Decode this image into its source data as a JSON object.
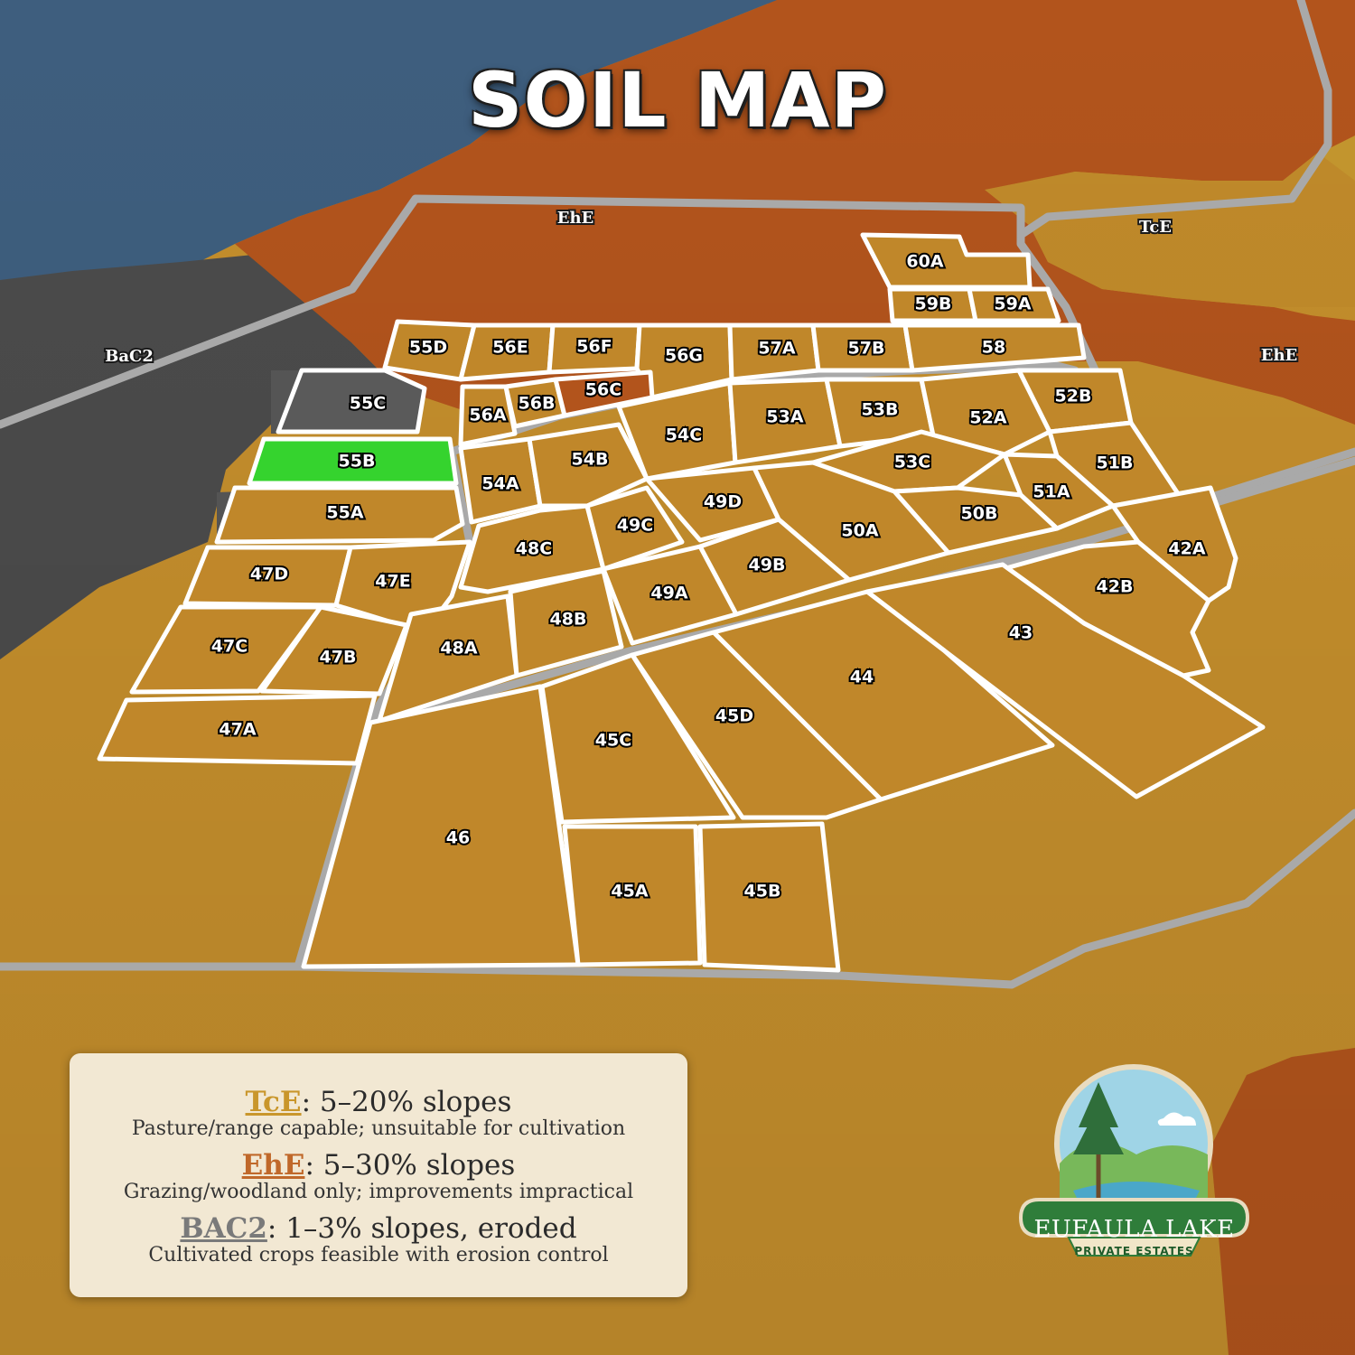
{
  "title": "SOIL MAP",
  "colors": {
    "water": "#3e5e7e",
    "ehe_soil": "#b2541c",
    "tce_soil": "#c99a2e",
    "bac2_soil": "#4a4a4a",
    "highlight_lot": "#35d32e",
    "lot_border": "#ffffff",
    "road": "#a9a9a9"
  },
  "soil_labels": [
    {
      "code": "EhE"
    },
    {
      "code": "TcE"
    },
    {
      "code": "BaC2"
    },
    {
      "code": "EhE"
    }
  ],
  "highlighted_lot": "55B",
  "lots": [
    "60A",
    "59B",
    "59A",
    "55D",
    "56E",
    "56F",
    "56G",
    "57A",
    "57B",
    "58",
    "55C",
    "56A",
    "56B",
    "56C",
    "54C",
    "53A",
    "53B",
    "52A",
    "52B",
    "55B",
    "54A",
    "54B",
    "53C",
    "51B",
    "51A",
    "49D",
    "50B",
    "55A",
    "48C",
    "49C",
    "50A",
    "42A",
    "47D",
    "47E",
    "49B",
    "42B",
    "49A",
    "48B",
    "43",
    "47C",
    "47B",
    "48A",
    "44",
    "45D",
    "47A",
    "45C",
    "46",
    "45A",
    "45B"
  ],
  "legend": [
    {
      "code": "TcE",
      "code_color": "#c9962b",
      "text": ": 5–20% slopes",
      "desc": "Pasture/range capable; unsuitable for cultivation"
    },
    {
      "code": "EhE",
      "code_color": "#c0682a",
      "text": ": 5–30% slopes",
      "desc": "Grazing/woodland only; improvements impractical"
    },
    {
      "code": "BAC2",
      "code_color": "#7a7a7a",
      "text": ": 1–3% slopes, eroded",
      "desc": "Cultivated crops feasible with erosion control"
    }
  ],
  "logo": {
    "name": "EUFAULA LAKE",
    "subtitle": "PRIVATE ESTATES"
  }
}
